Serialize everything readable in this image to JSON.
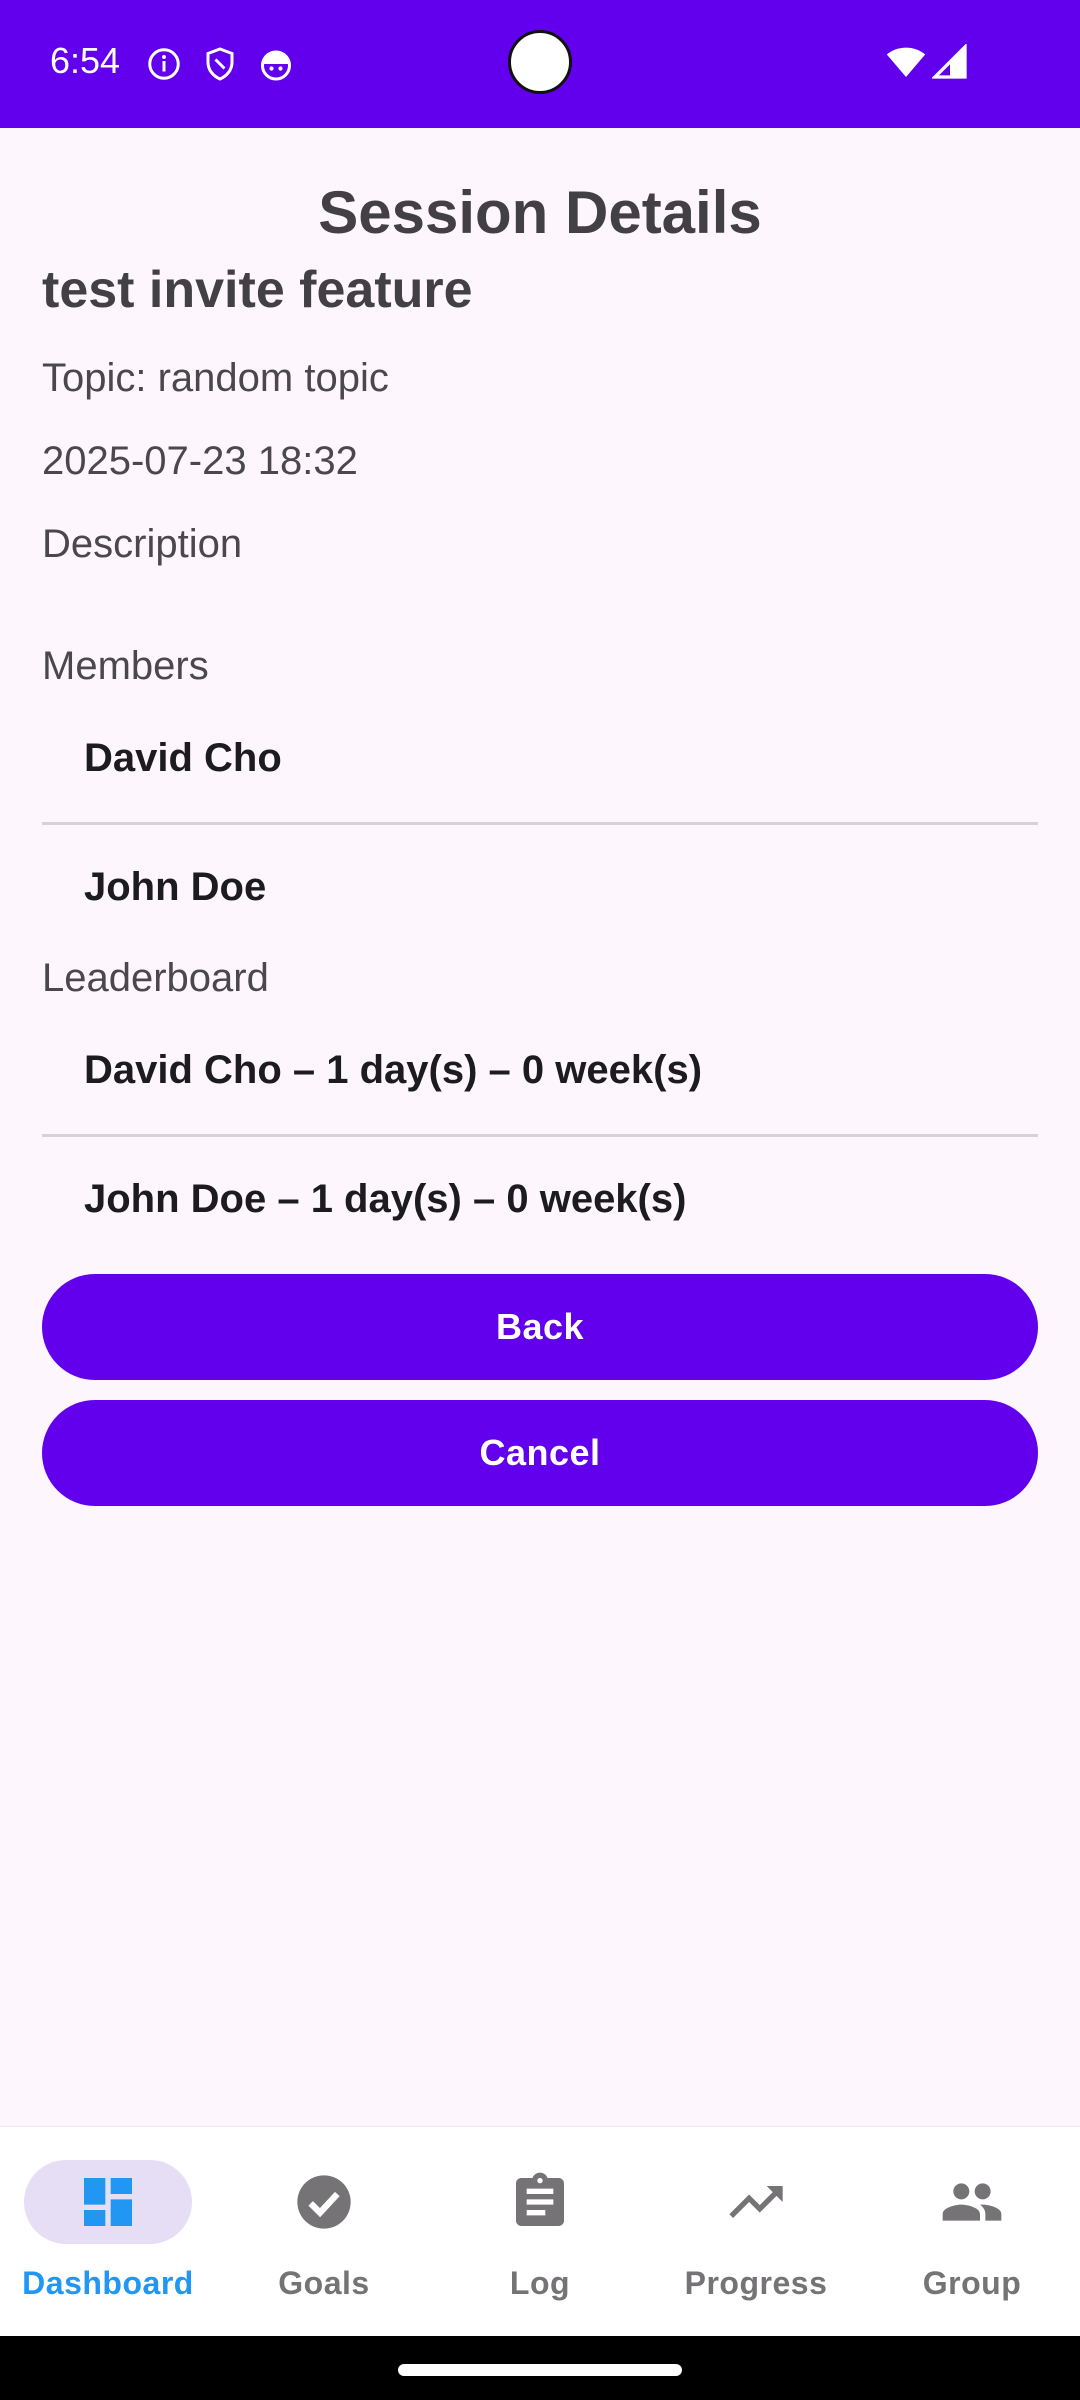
{
  "status_bar": {
    "time": "6:54",
    "left_icons": [
      "info-icon",
      "shield-icon",
      "android-head-icon"
    ],
    "right_icons": [
      "wifi-icon",
      "cell-signal-icon"
    ],
    "color": "#6200EE"
  },
  "page": {
    "title": "Session Details",
    "session_name": "test invite feature",
    "topic": "Topic: random topic",
    "datetime": "2025-07-23 18:32",
    "description_label": "Description"
  },
  "members": {
    "label": "Members",
    "items": [
      "David Cho",
      "John Doe"
    ]
  },
  "leaderboard": {
    "label": "Leaderboard",
    "items": [
      "David Cho – 1 day(s) – 0 week(s)",
      "John Doe – 1 day(s) – 0 week(s)"
    ]
  },
  "buttons": {
    "back": "Back",
    "cancel": "Cancel",
    "color": "#6200EE"
  },
  "bottom_nav": {
    "active": "Dashboard",
    "active_color": "#2196F3",
    "items": [
      {
        "label": "Dashboard",
        "icon": "dashboard-icon"
      },
      {
        "label": "Goals",
        "icon": "check-circle-icon"
      },
      {
        "label": "Log",
        "icon": "clipboard-icon"
      },
      {
        "label": "Progress",
        "icon": "trending-up-icon"
      },
      {
        "label": "Group",
        "icon": "group-icon"
      }
    ]
  }
}
